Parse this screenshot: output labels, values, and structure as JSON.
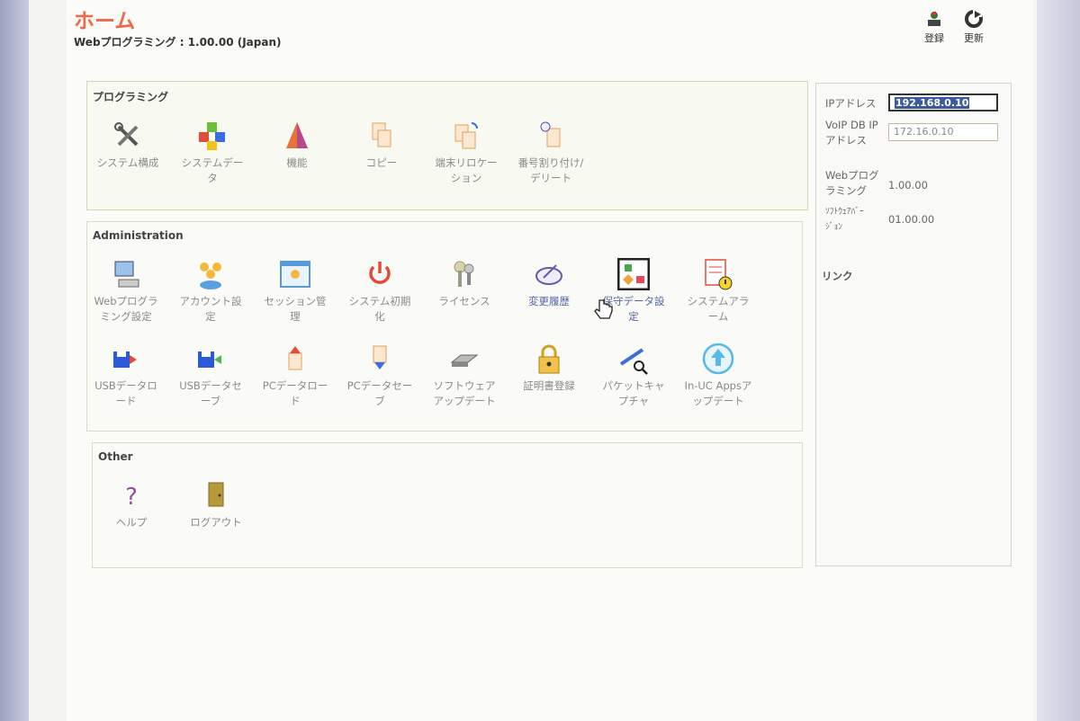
{
  "header": {
    "title": "ホーム",
    "version": "Webプログラミング : 1.00.00 (Japan)",
    "buttons": [
      {
        "label": "登録",
        "icon": "register-icon"
      },
      {
        "label": "更新",
        "icon": "refresh-icon"
      }
    ]
  },
  "programming": {
    "title": "プログラミング",
    "items": [
      {
        "label": "システム構成",
        "icon": "tools-icon"
      },
      {
        "label": "システムデー\nタ",
        "icon": "cubes-icon"
      },
      {
        "label": "機能",
        "icon": "cone-icon"
      },
      {
        "label": "コピー",
        "icon": "copy-icon"
      },
      {
        "label": "端末リロケー\nション",
        "icon": "relocation-icon"
      },
      {
        "label": "番号割り付け/\nデリート",
        "icon": "number-assign-icon"
      }
    ]
  },
  "administration": {
    "title": "Administration",
    "row1": [
      {
        "label": "Webプログラ\nミング設定",
        "icon": "computer-icon"
      },
      {
        "label": "アカウント設\n定",
        "icon": "users-icon"
      },
      {
        "label": "セッション管\n理",
        "icon": "session-icon"
      },
      {
        "label": "システム初期\n化",
        "icon": "power-icon"
      },
      {
        "label": "ライセンス",
        "icon": "keys-icon"
      },
      {
        "label": "変更履歴",
        "icon": "history-icon"
      },
      {
        "label": "保守データ設\n定",
        "icon": "maintenance-icon"
      },
      {
        "label": "システムアラ\nーム",
        "icon": "alarm-icon"
      }
    ],
    "row2": [
      {
        "label": "USBデータロ\nード",
        "icon": "usb-load-icon"
      },
      {
        "label": "USBデータセ\nーブ",
        "icon": "usb-save-icon"
      },
      {
        "label": "PCデータロー\nド",
        "icon": "pc-load-icon"
      },
      {
        "label": "PCデータセー\nブ",
        "icon": "pc-save-icon"
      },
      {
        "label": "ソフトウェア\nアップデート",
        "icon": "software-update-icon"
      },
      {
        "label": "証明書登録",
        "icon": "lock-icon"
      },
      {
        "label": "パケットキャ\nプチャ",
        "icon": "packet-capture-icon"
      },
      {
        "label": "In-UC Appsア\nップデート",
        "icon": "upload-icon"
      }
    ]
  },
  "other": {
    "title": "Other",
    "items": [
      {
        "label": "ヘルプ",
        "icon": "help-icon"
      },
      {
        "label": "ログアウト",
        "icon": "logout-icon"
      }
    ]
  },
  "sidebar": {
    "ip_label": "IPアドレス",
    "ip_value": "192.168.0.10",
    "voip_label": "VoIP DB IP\nアドレス",
    "voip_value": "172.16.0.10",
    "web_label": "Webプログ\nラミング",
    "web_value": "1.00.00",
    "sw_label": "ｿﾌﾄｳｪｱﾊﾞｰ\nｼﾞｮﾝ",
    "sw_value": "01.00.00",
    "link_label": "リンク"
  },
  "colors": {
    "title": "#f06a48",
    "link": "#5566a6",
    "selection": "#3d5a9c"
  }
}
